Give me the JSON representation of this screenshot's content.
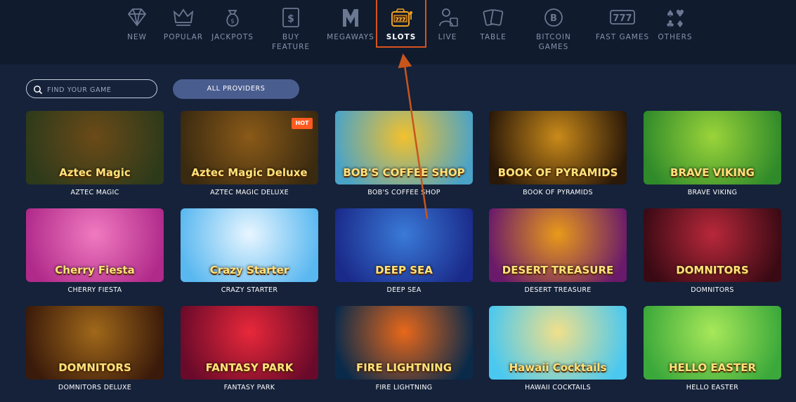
{
  "nav": {
    "items": [
      {
        "label": "NEW",
        "icon": "diamond-icon"
      },
      {
        "label": "POPULAR",
        "icon": "crown-icon"
      },
      {
        "label": "JACKPOTS",
        "icon": "money-bag-icon"
      },
      {
        "label": "BUY FEATURE",
        "icon": "dollar-card-icon"
      },
      {
        "label": "MEGAWAYS",
        "icon": "megaways-m-icon"
      },
      {
        "label": "SLOTS",
        "icon": "slot-machine-icon",
        "active": true
      },
      {
        "label": "LIVE",
        "icon": "live-dealer-icon"
      },
      {
        "label": "TABLE",
        "icon": "cards-icon"
      },
      {
        "label": "BITCOIN\nGAMES",
        "icon": "bitcoin-icon"
      },
      {
        "label": "FAST GAMES",
        "icon": "777-icon"
      },
      {
        "label": "OTHERS",
        "icon": "card-suits-icon"
      }
    ]
  },
  "search": {
    "placeholder": "FIND YOUR GAME",
    "value": ""
  },
  "providers": {
    "label": "ALL PROVIDERS"
  },
  "games": [
    {
      "name": "AZTEC MAGIC",
      "art_title": "Aztec Magic",
      "bg1": "#2d3a1a",
      "bg2": "#6b4a18"
    },
    {
      "name": "AZTEC MAGIC DELUXE",
      "art_title": "Aztec Magic Deluxe",
      "bg1": "#3a2a10",
      "bg2": "#8a5a18",
      "badge": "HOT"
    },
    {
      "name": "BOB'S COFFEE SHOP",
      "art_title": "BOB'S COFFEE SHOP",
      "bg1": "#4aa3c7",
      "bg2": "#f2c12e"
    },
    {
      "name": "BOOK OF PYRAMIDS",
      "art_title": "BOOK OF PYRAMIDS",
      "bg1": "#2a1808",
      "bg2": "#c98a1a"
    },
    {
      "name": "BRAVE VIKING",
      "art_title": "BRAVE VIKING",
      "bg1": "#2f8a2a",
      "bg2": "#9bd43a"
    },
    {
      "name": "CHERRY FIESTA",
      "art_title": "Cherry Fiesta",
      "bg1": "#b02a8a",
      "bg2": "#f07ac0"
    },
    {
      "name": "CRAZY STARTER",
      "art_title": "Crazy Starter",
      "bg1": "#5ab8f0",
      "bg2": "#e8f6ff"
    },
    {
      "name": "DEEP SEA",
      "art_title": "DEEP SEA",
      "bg1": "#1a2a8a",
      "bg2": "#3a7ad8"
    },
    {
      "name": "DESERT TREASURE",
      "art_title": "DESERT TREASURE",
      "bg1": "#6a1a6a",
      "bg2": "#e89a1a"
    },
    {
      "name": "DOMNITORS",
      "art_title": "DOMNITORS",
      "bg1": "#3a0a14",
      "bg2": "#b8283a"
    },
    {
      "name": "DOMNITORS DELUXE",
      "art_title": "DOMNITORS",
      "bg1": "#3a1a0a",
      "bg2": "#a0681a"
    },
    {
      "name": "FANTASY PARK",
      "art_title": "FANTASY PARK",
      "bg1": "#6a0a2a",
      "bg2": "#e8283a"
    },
    {
      "name": "FIRE LIGHTNING",
      "art_title": "FIRE LIGHTNING",
      "bg1": "#0a2a4a",
      "bg2": "#e8681a"
    },
    {
      "name": "HAWAII COCKTAILS",
      "art_title": "Hawaii Cocktails",
      "bg1": "#4ac8f0",
      "bg2": "#f0e08a"
    },
    {
      "name": "HELLO EASTER",
      "art_title": "HELLO EASTER",
      "bg1": "#3aa83a",
      "bg2": "#a8e85a"
    }
  ],
  "colors": {
    "accent": "#d9531e",
    "nav_bg": "#101b2e",
    "page_bg": "#15223a",
    "button_bg": "#4a5d8f"
  }
}
